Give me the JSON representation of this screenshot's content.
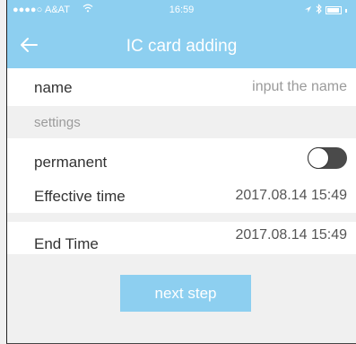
{
  "status_bar": {
    "signal": "●●●●○",
    "carrier": "A&AT",
    "wifi_icon": "wifi-icon",
    "time": "16:59",
    "location_icon": "location-arrow-icon",
    "bluetooth_icon": "bluetooth-icon",
    "battery_icon": "battery-icon"
  },
  "header": {
    "title": "IC card adding",
    "back_icon": "back-arrow-icon"
  },
  "form": {
    "name_label": "name",
    "name_placeholder": "input the name",
    "settings_section": "settings",
    "permanent_label": "permanent",
    "permanent_on": false,
    "effective_label": "Effective time",
    "effective_value": "2017.08.14 15:49",
    "end_label": "End Time",
    "end_value": "2017.08.14 15:49"
  },
  "actions": {
    "next_label": "next step"
  },
  "colors": {
    "accent": "#8dcff0",
    "background": "#f0f0f0",
    "toggle_off": "#4a4a4a"
  }
}
